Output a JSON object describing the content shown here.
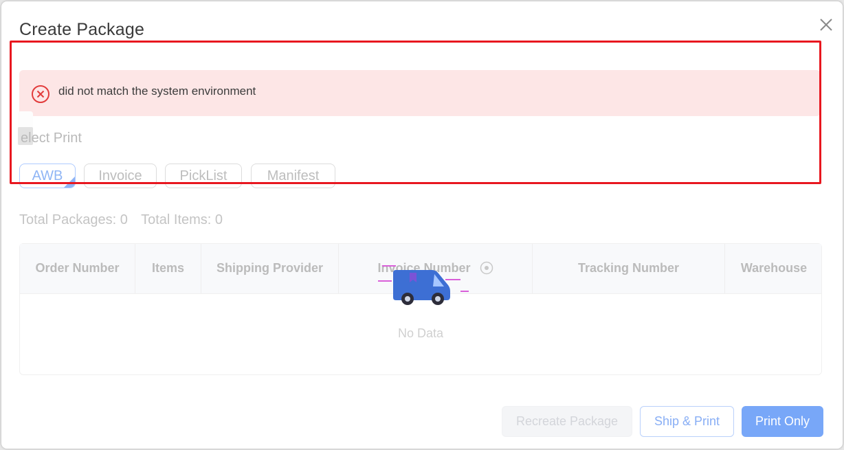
{
  "dialog": {
    "title": "Create Package",
    "close_icon": "close-icon"
  },
  "alert": {
    "icon": "error-circle-icon",
    "message": "did not match the system environment",
    "colors": {
      "background": "#fde6e6",
      "icon": "#e23b3b"
    }
  },
  "highlight": {
    "color": "#e8171f"
  },
  "print": {
    "label": "elect Print",
    "tabs": [
      {
        "label": "AWB",
        "selected": true
      },
      {
        "label": "Invoice",
        "selected": false
      },
      {
        "label": "PickList",
        "selected": false
      },
      {
        "label": "Manifest",
        "selected": false
      }
    ]
  },
  "totals": {
    "packages": "Total Packages: 0",
    "items": "Total Items: 0"
  },
  "table": {
    "columns": [
      "Order Number",
      "Items",
      "Shipping Provider",
      "Invoice Number",
      "Tracking Number",
      "Warehouse"
    ],
    "empty_text": "No Data",
    "loading_icon": "delivery-truck-icon"
  },
  "footer": {
    "recreate_label": "Recreate Package",
    "ship_print_label": "Ship & Print",
    "print_only_label": "Print Only",
    "accent": "#78a7f8"
  }
}
